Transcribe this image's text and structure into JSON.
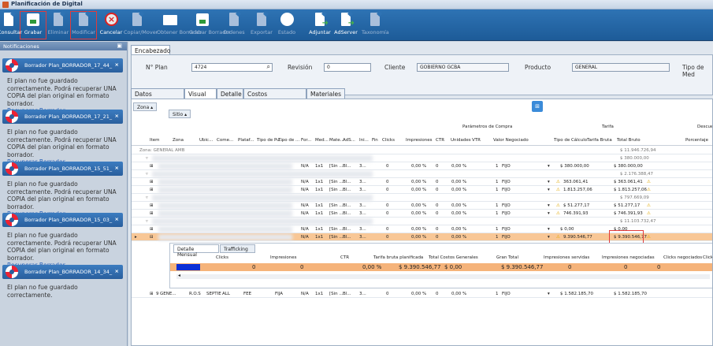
{
  "window": {
    "title": "Planificación de Digital"
  },
  "toolbar": [
    {
      "label": "Consultar",
      "icon": "consult-icon",
      "disabled": false,
      "highlighted": false
    },
    {
      "label": "Grabar",
      "icon": "save-icon",
      "disabled": false,
      "highlighted": true
    },
    {
      "label": "Eliminar",
      "icon": "delete-icon",
      "disabled": true,
      "highlighted": false
    },
    {
      "label": "Modificar",
      "icon": "edit-icon",
      "disabled": true,
      "highlighted": true
    },
    {
      "label": "Cancelar",
      "icon": "cancel-icon",
      "disabled": false,
      "highlighted": false
    },
    {
      "label": "Copiar/Mover",
      "icon": "copy-icon",
      "disabled": true,
      "highlighted": false
    },
    {
      "label": "Obtener Borrador",
      "icon": "folder-icon",
      "disabled": true,
      "highlighted": false
    },
    {
      "label": "Grabar Borrador",
      "icon": "save-draft-icon",
      "disabled": true,
      "highlighted": false
    },
    {
      "label": "Ordenes",
      "icon": "orders-icon",
      "disabled": true,
      "highlighted": false
    },
    {
      "label": "Exportar",
      "icon": "export-icon",
      "disabled": true,
      "highlighted": false
    },
    {
      "label": "Estado",
      "icon": "status-icon",
      "disabled": true,
      "highlighted": false
    },
    {
      "label": "Adjuntar",
      "icon": "attach-icon",
      "disabled": false,
      "highlighted": false
    },
    {
      "label": "AdServer",
      "icon": "adserver-icon",
      "disabled": false,
      "highlighted": false
    },
    {
      "label": "Taxonomía",
      "icon": "taxonomy-icon",
      "disabled": true,
      "highlighted": false
    }
  ],
  "sidebar": {
    "title": "Notificaciones",
    "notifications": [
      {
        "title": "Borrador Plan_BORRADOR_17_44_",
        "message": "El plan no fue guardado correctamente. Podrá recuperar UNA COPIA del plan original en formato borrador.",
        "link": "Recuperar Borrador"
      },
      {
        "title": "Borrador Plan_BORRADOR_17_21_",
        "message": "El plan no fue guardado correctamente. Podrá recuperar UNA COPIA del plan original en formato borrador.",
        "link": "Recuperar Borrador"
      },
      {
        "title": "Borrador Plan_BORRADOR_15_51_",
        "message": "El plan no fue guardado correctamente. Podrá recuperar UNA COPIA del plan original en formato borrador.",
        "link": "Recuperar Borrador"
      },
      {
        "title": "Borrador Plan_BORRADOR_15_03_",
        "message": "El plan no fue guardado correctamente. Podrá recuperar UNA COPIA del plan original en formato borrador.",
        "link": "Recuperar Borrador"
      },
      {
        "title": "Borrador Plan_BORRADOR_14_34_",
        "message": "El plan no fue guardado correctamente.",
        "link": ""
      }
    ]
  },
  "header": {
    "tab": "Encabezado",
    "plan_label": "N° Plan",
    "plan_value": "4724",
    "revision_label": "Revisión",
    "revision_value": "0",
    "cliente_label": "Cliente",
    "cliente_value": "GOBIERNO GCBA",
    "producto_label": "Producto",
    "producto_value": "GENERAL",
    "tipo_label": "Tipo de Med"
  },
  "detail_tabs": [
    "Datos Principales",
    "Visual",
    "Detalle",
    "Costos Adicionales",
    "Materiales"
  ],
  "grid": {
    "group_buttons": [
      "Zona",
      "Sitio"
    ],
    "group_header_compra": "Parámetros de Compra",
    "group_header_tarifa": "Tarifa",
    "group_header_descuento": "Descue",
    "columns": [
      "Item",
      "Zona",
      "Ubic...",
      "Come...",
      "Plataf...",
      "Tipo de Pu...",
      "Tipo de ...",
      "For...",
      "Med...",
      "Mate...",
      "AdS...",
      "Ini...",
      "Fin",
      "Clicks",
      "Impresiones",
      "CTR",
      "Unidades",
      "VTR",
      "Valor Negociado",
      "Tipo de Cálculo",
      "Tarifa Bruta",
      "Total Bruto",
      "Porcentaje"
    ],
    "zona_group": "Zona: GENERAL AMB",
    "zona_total": "$ 11.946.726,94",
    "rows": [
      {
        "type": "grp",
        "total": "$ 380.000,00"
      },
      {
        "type": "data",
        "na": "N/A",
        "med": "1x1",
        "mate": "[Sin ...",
        "ads": "Bl...",
        "ini": "3...",
        "clicks": "0",
        "ctr": "0,00 %",
        "vtr": "0,00 %",
        "unid": "0",
        "valor": "1",
        "calc": "FIJO",
        "warn": false,
        "tarifa": "$ 380.000,00",
        "total": "$ 380.000,00",
        "warn2": false
      },
      {
        "type": "grp",
        "total": "$ 2.176.388,47"
      },
      {
        "type": "data",
        "na": "N/A",
        "med": "1x1",
        "mate": "[Sin ...",
        "ads": "Bl...",
        "ini": "3...",
        "clicks": "0",
        "ctr": "0,00 %",
        "vtr": "0,00 %",
        "unid": "0",
        "valor": "1",
        "calc": "FIJO",
        "warn": true,
        "tarifa": "363.061,41",
        "total": "$ 363.061,41",
        "warn2": true
      },
      {
        "type": "data",
        "na": "N/A",
        "med": "1x1",
        "mate": "[Sin ...",
        "ads": "Bl...",
        "ini": "3...",
        "clicks": "0",
        "ctr": "0,00 %",
        "vtr": "0,00 %",
        "unid": "0",
        "valor": "1",
        "calc": "FIJO",
        "warn": true,
        "tarifa": "1.813.257,06",
        "total": "$ 1.813.257,06",
        "warn2": true
      },
      {
        "type": "grp",
        "total": "$ 797.669,09"
      },
      {
        "type": "data",
        "na": "N/A",
        "med": "1x1",
        "mate": "[Sin ...",
        "ads": "Bl...",
        "ini": "3...",
        "clicks": "0",
        "ctr": "0,00 %",
        "vtr": "0,00 %",
        "unid": "0",
        "valor": "1",
        "calc": "FIJO",
        "warn": true,
        "tarifa": "$ 51.277,17",
        "total": "$ 51.277,17",
        "warn2": true
      },
      {
        "type": "data",
        "na": "N/A",
        "med": "1x1",
        "mate": "[Sin ...",
        "ads": "Bl...",
        "ini": "3...",
        "clicks": "0",
        "ctr": "0,00 %",
        "vtr": "0,00 %",
        "unid": "0",
        "valor": "1",
        "calc": "FIJO",
        "warn": true,
        "tarifa": "746.391,93",
        "total": "$ 746.391,93",
        "warn2": true
      },
      {
        "type": "grp",
        "total": "$ 11.103.732,47"
      },
      {
        "type": "data",
        "na": "N/A",
        "med": "1x1",
        "mate": "[Sin ...",
        "ads": "Bl...",
        "ini": "3...",
        "clicks": "0",
        "ctr": "0,00 %",
        "vtr": "0,00 %",
        "unid": "0",
        "valor": "1",
        "calc": "FIJO",
        "warn": false,
        "tarifa": "$ 0,00",
        "total": "$ 0,00",
        "warn2": false
      },
      {
        "type": "sel",
        "na": "N/A",
        "med": "1x1",
        "mate": "[Sin ...",
        "ads": "Bl...",
        "ini": "3...",
        "clicks": "0",
        "ctr": "0,00 %",
        "vtr": "0,00 %",
        "unid": "0",
        "valor": "1",
        "calc": "FIJO",
        "warn": true,
        "tarifa": "9.390.546,77",
        "total": "$ 9.390.546,77",
        "warn2": true
      }
    ],
    "last_row": {
      "item": "9",
      "zona": "GENE...",
      "ubic": "R.O.S",
      "come": "SEPTIE",
      "plat": "ALL",
      "tipopu": "FEE",
      "tipo2": "FIJA",
      "na": "N/A",
      "med": "1x1",
      "mate": "[Sin ...",
      "ads": "Bl...",
      "ini": "3...",
      "clicks": "0",
      "ctr": "0,00 %",
      "vtr": "0,00 %",
      "unid": "0",
      "valor": "1",
      "calc": "FIJO",
      "tarifa": "$ 1.582.185,70",
      "total": "$ 1.582.185,70"
    }
  },
  "subgrid": {
    "tabs": [
      "Detalle Mensual",
      "Trafficking"
    ],
    "columns": [
      "Clicks",
      "Impresiones",
      "CTR",
      "Tarifa bruta planificada",
      "Total Costos Generales",
      "Gran Total",
      "Impresiones servidas",
      "Impresiones negociadas",
      "Clicks negociados",
      "Clicks"
    ],
    "values": [
      "0",
      "0",
      "0,00 %",
      "$ 9.390.546,77",
      "$ 0,00",
      "$ 9.390.546,77",
      "0",
      "0",
      "0"
    ]
  }
}
